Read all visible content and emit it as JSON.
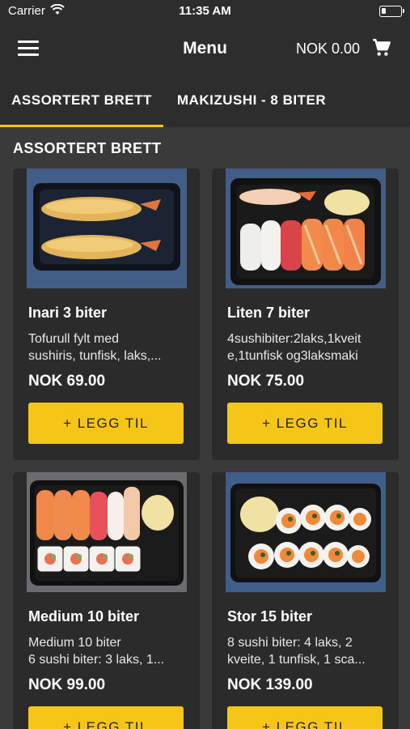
{
  "statusbar": {
    "carrier": "Carrier",
    "time": "11:35 AM"
  },
  "navbar": {
    "title": "Menu",
    "cart_total": "NOK 0.00",
    "icons": {
      "menu": "hamburger-icon",
      "cart": "cart-icon"
    }
  },
  "tabs": [
    {
      "label": "ASSORTERT BRETT",
      "active": true
    },
    {
      "label": "MAKIZUSHI - 8 BITER",
      "active": false
    }
  ],
  "section": {
    "title": "ASSORTERT BRETT"
  },
  "products": [
    {
      "name": "Inari 3 biter",
      "desc_line1": "Tofurull fylt med",
      "desc_line2": "sushiris, tunfisk, laks,...",
      "price": "NOK 69.00",
      "button": "+ LEGG TIL"
    },
    {
      "name": "Liten 7 biter",
      "desc_line1": "4sushibiter:2laks,1kveit",
      "desc_line2": "e,1tunfisk og3laksmaki",
      "price": "NOK 75.00",
      "button": "+ LEGG TIL"
    },
    {
      "name": "Medium 10 biter",
      "desc_line1": "Medium 10 biter",
      "desc_line2": "6 sushi biter: 3 laks, 1...",
      "price": "NOK 99.00",
      "button": "+ LEGG TIL"
    },
    {
      "name": "Stor 15 biter",
      "desc_line1": "8 sushi biter: 4 laks, 2",
      "desc_line2": "kveite, 1 tunfisk, 1 sca...",
      "price": "NOK 139.00",
      "button": "+ LEGG TIL"
    }
  ],
  "colors": {
    "accent": "#f5c518",
    "background": "#3a3a3a",
    "bar": "#2d2d2d",
    "card": "#2b2b2b"
  }
}
